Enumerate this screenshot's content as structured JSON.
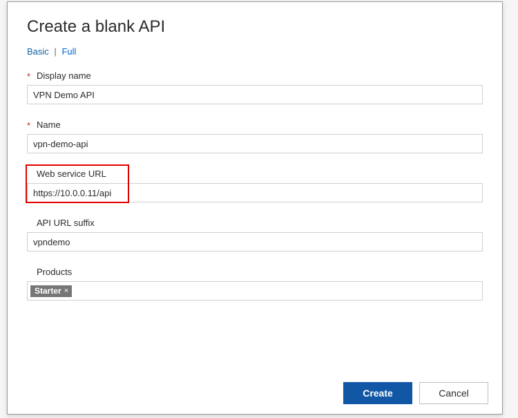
{
  "dialog": {
    "title": "Create a blank API",
    "tabs": {
      "basic": "Basic",
      "full": "Full",
      "active": "Basic"
    },
    "fields": {
      "display_name": {
        "label": "Display name",
        "required": true,
        "value": "VPN Demo API"
      },
      "name": {
        "label": "Name",
        "required": true,
        "value": "vpn-demo-api"
      },
      "web_url": {
        "label": "Web service URL",
        "required": false,
        "value": "https://10.0.0.11/api"
      },
      "suffix": {
        "label": "API URL suffix",
        "required": false,
        "value": "vpndemo"
      },
      "products": {
        "label": "Products",
        "required": false,
        "tags": [
          "Starter"
        ]
      }
    },
    "buttons": {
      "create": "Create",
      "cancel": "Cancel"
    }
  }
}
